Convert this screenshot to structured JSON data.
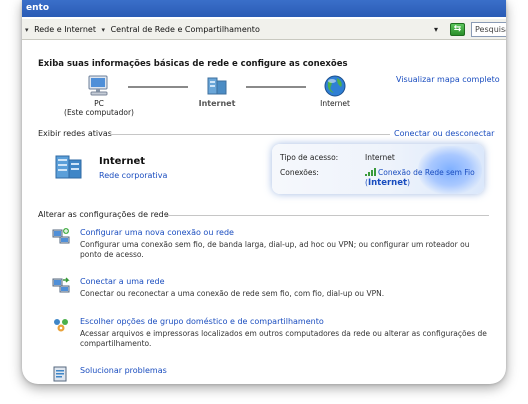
{
  "window": {
    "title": "ento"
  },
  "address_bar": {
    "breadcrumbs": [
      "Rede e Internet",
      "Central de Rede e Compartilhamento"
    ],
    "search_placeholder": "Pesquisar"
  },
  "main": {
    "title": "Exiba suas informações básicas de rede e configure as conexões",
    "map_link": "Visualizar mapa completo",
    "map_nodes": [
      {
        "label": "PC",
        "sublabel": "(Este computador)"
      },
      {
        "label": "Internet"
      },
      {
        "label": "Internet"
      }
    ]
  },
  "active_networks": {
    "header": "Exibir redes ativas",
    "connect_link": "Conectar ou desconectar",
    "network_name": "Internet",
    "network_type": "Rede corporativa",
    "access_label": "Tipo de acesso:",
    "access_value": "Internet",
    "connections_label": "Conexões:",
    "connection_name": "Conexão de Rede sem Fio",
    "connection_network_open": "(",
    "connection_network": "Internet",
    "connection_network_close": ")"
  },
  "settings": {
    "header": "Alterar as configurações de rede",
    "tasks": [
      {
        "icon": "new-connection-icon",
        "title": "Configurar uma nova conexão ou rede",
        "description": "Configurar uma conexão sem fio, de banda larga, dial-up, ad hoc ou VPN; ou configurar um roteador ou ponto de acesso."
      },
      {
        "icon": "connect-network-icon",
        "title": "Conectar a uma rede",
        "description": "Conectar ou reconectar a uma conexão de rede sem fio, com fio, dial-up ou VPN."
      },
      {
        "icon": "homegroup-icon",
        "title": "Escolher opções de grupo doméstico e de compartilhamento",
        "description": "Acessar arquivos e impressoras localizados em outros computadores da rede ou alterar as configurações de compartilhamento."
      },
      {
        "icon": "troubleshoot-icon",
        "title": "Solucionar problemas",
        "description": ""
      }
    ]
  },
  "colors": {
    "link": "#1a4dbf",
    "title_bar": "#2a5bb5",
    "panel_glow": "#7fb0ff"
  }
}
